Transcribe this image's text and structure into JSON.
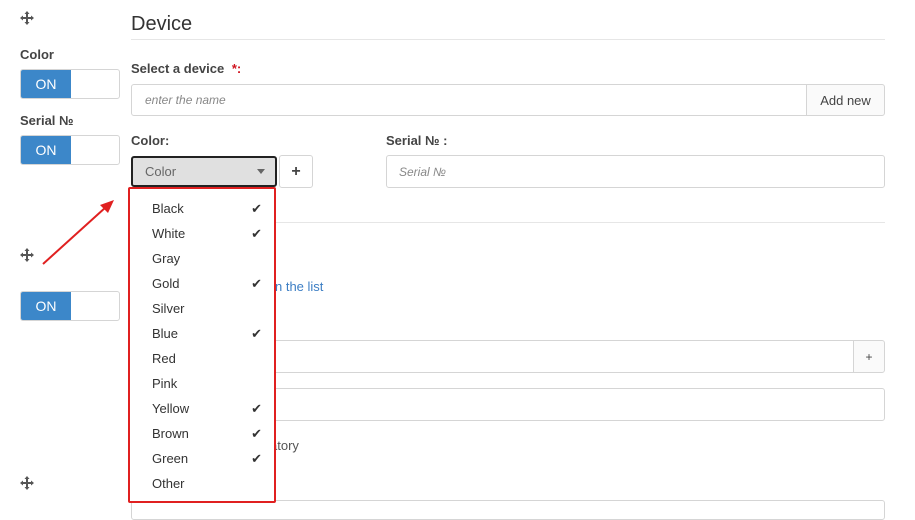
{
  "left": {
    "color_label": "Color",
    "serial_label": "Serial №",
    "toggle_on_label": "ON"
  },
  "section": {
    "title": "Device"
  },
  "select_device": {
    "label": "Select a device",
    "required_mark": "*:",
    "placeholder": "enter the name",
    "add_new_label": "Add new"
  },
  "color": {
    "label": "Color:",
    "selected": "Color",
    "plus": "+"
  },
  "serial": {
    "label": "Serial № :",
    "placeholder": "Serial №"
  },
  "dropdown": {
    "options": [
      {
        "label": "Black",
        "checked": "✔"
      },
      {
        "label": "White",
        "checked": "✔"
      },
      {
        "label": "Gray",
        "checked": ""
      },
      {
        "label": "Gold",
        "checked": "✔"
      },
      {
        "label": "Silver",
        "checked": ""
      },
      {
        "label": "Blue",
        "checked": "✔"
      },
      {
        "label": "Red",
        "checked": ""
      },
      {
        "label": "Pink",
        "checked": ""
      },
      {
        "label": "Yellow",
        "checked": "✔"
      },
      {
        "label": "Brown",
        "checked": "✔"
      },
      {
        "label": "Green",
        "checked": "✔"
      },
      {
        "label": "Other",
        "checked": ""
      }
    ]
  },
  "background": {
    "link_fragment": "n the list",
    "plus_addon": "+",
    "mandatory_fragment": "atory"
  },
  "colors": {
    "toggle_blue": "#3c87c9",
    "highlight_red": "#e02020",
    "link_blue": "#3c7ec4"
  },
  "icons": [
    "move-icon",
    "caret-down-icon",
    "check-icon",
    "plus-icon",
    "annotation-arrow"
  ]
}
